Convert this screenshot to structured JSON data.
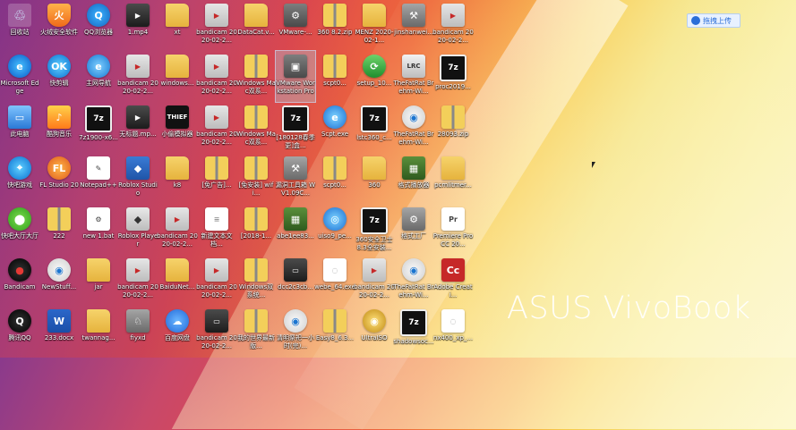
{
  "brand_text": "ASUS VivoBook",
  "cloud_button_label": "拖拽上传",
  "icons": [
    {
      "label": "回收站",
      "kind": "recycle",
      "glyph": "♲",
      "name": "recycle-bin-icon"
    },
    {
      "label": "火绒安全软件",
      "kind": "shield",
      "glyph": "火",
      "name": "huorong-security-icon"
    },
    {
      "label": "QQ浏览器",
      "kind": "qqbrowser",
      "glyph": "Q",
      "name": "qq-browser-icon"
    },
    {
      "label": "1.mp4",
      "kind": "video",
      "glyph": "▶",
      "name": "video-file-icon"
    },
    {
      "label": "xt",
      "kind": "folder",
      "glyph": "",
      "name": "folder-icon"
    },
    {
      "label": "bandicam 2020-02-2...",
      "kind": "bandicam",
      "glyph": "▶",
      "name": "bandicam-video-icon"
    },
    {
      "label": "DataCat.v...",
      "kind": "folder",
      "glyph": "",
      "name": "folder-icon"
    },
    {
      "label": "VMware-...",
      "kind": "vmware",
      "glyph": "⚙",
      "name": "vmware-installer-icon"
    },
    {
      "label": "360 8.2.zip",
      "kind": "zip",
      "glyph": "",
      "name": "zip-file-icon"
    },
    {
      "label": "MENZ 2020-02-1...",
      "kind": "folder",
      "glyph": "",
      "name": "folder-icon"
    },
    {
      "label": "jinshanwei...",
      "kind": "tool",
      "glyph": "⚒",
      "name": "tool-icon"
    },
    {
      "label": "bandicam 2020-02-2...",
      "kind": "bandicam",
      "glyph": "▶",
      "name": "bandicam-video-icon"
    },
    {
      "label": "Microsoft Edge",
      "kind": "edge",
      "glyph": "e",
      "name": "edge-browser-icon"
    },
    {
      "label": "快剪辑",
      "kind": "game",
      "glyph": "OK",
      "name": "kuaijianji-icon"
    },
    {
      "label": "主网导航",
      "kind": "ie",
      "glyph": "e",
      "name": "ie-browser-icon"
    },
    {
      "label": "bandicam 2020-02-2...",
      "kind": "bandicam",
      "glyph": "▶",
      "name": "bandicam-video-icon"
    },
    {
      "label": "windows...",
      "kind": "folder",
      "glyph": "",
      "name": "folder-icon"
    },
    {
      "label": "bandicam 2020-02-2...",
      "kind": "bandicam",
      "glyph": "▶",
      "name": "bandicam-video-icon"
    },
    {
      "label": "Windows Mac双系...",
      "kind": "zip",
      "glyph": "",
      "name": "zip-file-icon"
    },
    {
      "label": "VMware Workstation Pro",
      "kind": "vmware",
      "glyph": "▣",
      "name": "vmware-workstation-icon"
    },
    {
      "label": "scpt0...",
      "kind": "zip",
      "glyph": "",
      "name": "zip-file-icon"
    },
    {
      "label": "setup_10...",
      "kind": "green",
      "glyph": "⟳",
      "name": "setup-icon"
    },
    {
      "label": "TheFatRat Brehm-Wi...",
      "kind": "lrc",
      "glyph": "LRC",
      "name": "lrc-file-icon"
    },
    {
      "label": "proc2019...",
      "kind": "7z",
      "glyph": "7z",
      "name": "7z-archive-icon"
    },
    {
      "label": "此电脑",
      "kind": "pc",
      "glyph": "▭",
      "name": "this-pc-icon"
    },
    {
      "label": "酷狗音乐",
      "kind": "music",
      "glyph": "♪",
      "name": "music-app-icon"
    },
    {
      "label": "7z1900-x6...",
      "kind": "7z",
      "glyph": "7z",
      "name": "7z-archive-icon"
    },
    {
      "label": "无标题.mp...",
      "kind": "video",
      "glyph": "▶",
      "name": "video-file-icon"
    },
    {
      "label": "小偷模拟器",
      "kind": "thief",
      "glyph": "THIEF",
      "name": "thief-game-icon"
    },
    {
      "label": "bandicam 2020-02-2...",
      "kind": "bandicam",
      "glyph": "▶",
      "name": "bandicam-video-icon"
    },
    {
      "label": "Windows Mac双系...",
      "kind": "zip",
      "glyph": "",
      "name": "zip-file-icon"
    },
    {
      "label": "[180128春季 更]盒...",
      "kind": "7z",
      "glyph": "7z",
      "name": "7z-archive-icon"
    },
    {
      "label": "Scpt.exe",
      "kind": "earth",
      "glyph": "e",
      "name": "exe-file-icon"
    },
    {
      "label": "lstc360_c...",
      "kind": "7z",
      "glyph": "7z",
      "name": "7z-archive-icon"
    },
    {
      "label": "TheFatRat Brehm-Wi...",
      "kind": "media",
      "glyph": "◉",
      "name": "media-file-icon"
    },
    {
      "label": "28093.zip",
      "kind": "zip",
      "glyph": "",
      "name": "zip-file-icon"
    },
    {
      "label": "快吧游戏",
      "kind": "game",
      "glyph": "⌖",
      "name": "kuaiba-game-icon"
    },
    {
      "label": "FL Studio 20",
      "kind": "fl",
      "glyph": "FL",
      "name": "fl-studio-icon"
    },
    {
      "label": "Notepad++",
      "kind": "doc",
      "glyph": "✎",
      "name": "notepad-icon"
    },
    {
      "label": "Roblox Studio",
      "kind": "roblox",
      "glyph": "◆",
      "name": "roblox-studio-icon"
    },
    {
      "label": "k8",
      "kind": "folder",
      "glyph": "",
      "name": "folder-icon"
    },
    {
      "label": "[免广告]...",
      "kind": "zip",
      "glyph": "",
      "name": "zip-file-icon"
    },
    {
      "label": "[免安装] wifi...",
      "kind": "zip",
      "glyph": "",
      "name": "zip-file-icon"
    },
    {
      "label": "漏洞工具箱 WV1.09C...",
      "kind": "tool",
      "glyph": "⚒",
      "name": "tool-icon"
    },
    {
      "label": "scpt0...",
      "kind": "zip",
      "glyph": "",
      "name": "zip-file-icon"
    },
    {
      "label": "360",
      "kind": "folder",
      "glyph": "",
      "name": "folder-icon"
    },
    {
      "label": "格式播放器",
      "kind": "pic",
      "glyph": "▦",
      "name": "player-icon"
    },
    {
      "label": "pcmlitmer...",
      "kind": "folder",
      "glyph": "",
      "name": "folder-icon"
    },
    {
      "label": "快吧大厅大厅",
      "kind": "store",
      "glyph": "⬤",
      "name": "kuaiba-lobby-icon"
    },
    {
      "label": "222",
      "kind": "zip",
      "glyph": "",
      "name": "zip-file-icon"
    },
    {
      "label": "new 1.bat",
      "kind": "doc",
      "glyph": "⚙",
      "name": "bat-file-icon"
    },
    {
      "label": "Roblox Player",
      "kind": "roblox-w",
      "glyph": "◆",
      "name": "roblox-player-icon"
    },
    {
      "label": "bandicam 2020-02-2...",
      "kind": "bandicam",
      "glyph": "▶",
      "name": "bandicam-video-icon"
    },
    {
      "label": "新建文本文档...",
      "kind": "txt",
      "glyph": "≡",
      "name": "text-file-icon"
    },
    {
      "label": "[2018-1...",
      "kind": "zip",
      "glyph": "",
      "name": "zip-file-icon"
    },
    {
      "label": "abe1ee83...",
      "kind": "pic",
      "glyph": "▦",
      "name": "image-file-icon"
    },
    {
      "label": "uiso9_pe...",
      "kind": "earth",
      "glyph": "◎",
      "name": "uiso-installer-icon"
    },
    {
      "label": "360安全卫士 8.3全安装...",
      "kind": "7z",
      "glyph": "7z",
      "name": "7z-archive-icon"
    },
    {
      "label": "格式工厂",
      "kind": "tool",
      "glyph": "⚙",
      "name": "format-factory-icon"
    },
    {
      "label": "Premiere Pro CC 20...",
      "kind": "doc",
      "glyph": "Pr",
      "name": "premiere-file-icon"
    },
    {
      "label": "Bandicam",
      "kind": "bandi-red",
      "glyph": "●",
      "name": "bandicam-app-icon"
    },
    {
      "label": "NewStuff...",
      "kind": "media",
      "glyph": "◉",
      "name": "media-file-icon"
    },
    {
      "label": "jar",
      "kind": "folder",
      "glyph": "",
      "name": "folder-icon"
    },
    {
      "label": "bandicam 2020-02-2...",
      "kind": "bandicam",
      "glyph": "▶",
      "name": "bandicam-video-icon"
    },
    {
      "label": "BaiduNet...",
      "kind": "folder",
      "glyph": "",
      "name": "folder-icon"
    },
    {
      "label": "bandicam 2020-02-2...",
      "kind": "bandicam",
      "glyph": "▶",
      "name": "bandicam-video-icon"
    },
    {
      "label": "Windows双 系统...",
      "kind": "zip",
      "glyph": "",
      "name": "zip-file-icon"
    },
    {
      "label": "dcc2c3cb...",
      "kind": "video",
      "glyph": "▭",
      "name": "video-file-icon"
    },
    {
      "label": "webe_64.exe",
      "kind": "txt",
      "glyph": "◌",
      "name": "exe-file-icon"
    },
    {
      "label": "bandicam 2020-02-2...",
      "kind": "bandicam",
      "glyph": "▶",
      "name": "bandicam-video-icon"
    },
    {
      "label": "TheFatRat Brehm-Wi...",
      "kind": "media",
      "glyph": "◉",
      "name": "media-file-icon"
    },
    {
      "label": "Adobe Creati...",
      "kind": "adobe",
      "glyph": "Cc",
      "name": "adobe-cc-icon"
    },
    {
      "label": "腾讯QQ",
      "kind": "qq",
      "glyph": "Q",
      "name": "tencent-qq-icon"
    },
    {
      "label": "233.docx",
      "kind": "word",
      "glyph": "W",
      "name": "word-doc-icon"
    },
    {
      "label": "twannag...",
      "kind": "folder",
      "glyph": "",
      "name": "folder-icon"
    },
    {
      "label": "fiyxd",
      "kind": "tool",
      "glyph": "♘",
      "name": "game-icon"
    },
    {
      "label": "百度网盘",
      "kind": "baidu",
      "glyph": "☁",
      "name": "baidu-netdisk-icon"
    },
    {
      "label": "bandicam 2020-02-2...",
      "kind": "video",
      "glyph": "▭",
      "name": "bandicam-video-icon"
    },
    {
      "label": "我的世界最新版...",
      "kind": "zip",
      "glyph": "",
      "name": "zip-file-icon"
    },
    {
      "label": "清明祭祀一小 时(完)...",
      "kind": "media",
      "glyph": "◉",
      "name": "media-file-icon"
    },
    {
      "label": "Easy8_6.3...",
      "kind": "zip",
      "glyph": "",
      "name": "zip-file-icon"
    },
    {
      "label": "UltraISO",
      "kind": "iso",
      "glyph": "◉",
      "name": "ultraiso-icon"
    },
    {
      "label": "shadowsoc...",
      "kind": "7z",
      "glyph": "7z",
      "name": "7z-archive-icon"
    },
    {
      "label": "nx400_xp_...",
      "kind": "txt",
      "glyph": "◌",
      "name": "exe-file-icon"
    }
  ],
  "selected_index": 19
}
